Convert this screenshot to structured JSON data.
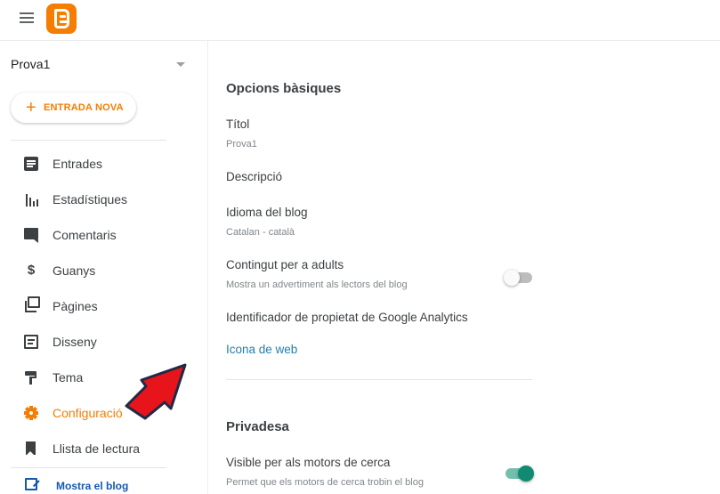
{
  "header": {
    "menu_icon": "hamburger-menu-icon",
    "logo_icon": "blogger-logo-icon",
    "brand_color": "#f57d00"
  },
  "sidebar": {
    "blog_name": "Prova1",
    "new_post_label": "ENTRADA NOVA",
    "items": [
      {
        "label": "Entrades",
        "icon": "posts-icon"
      },
      {
        "label": "Estadístiques",
        "icon": "stats-icon"
      },
      {
        "label": "Comentaris",
        "icon": "comments-icon"
      },
      {
        "label": "Guanys",
        "icon": "dollar-icon"
      },
      {
        "label": "Pàgines",
        "icon": "pages-icon"
      },
      {
        "label": "Disseny",
        "icon": "layout-icon"
      },
      {
        "label": "Tema",
        "icon": "theme-roller-icon"
      },
      {
        "label": "Configuració",
        "icon": "gear-icon",
        "active": true
      },
      {
        "label": "Llista de lectura",
        "icon": "bookmark-icon"
      }
    ],
    "view_blog_label": "Mostra el blog",
    "view_blog_icon": "external-link-icon"
  },
  "main": {
    "basic": {
      "title": "Opcions bàsiques",
      "title_label": "Títol",
      "title_value": "Prova1",
      "description_label": "Descripció",
      "language_label": "Idioma del blog",
      "language_value": "Catalan - català",
      "adult_label": "Contingut per a adults",
      "adult_help": "Mostra un advertiment als lectors del blog",
      "adult_enabled": false,
      "analytics_label": "Identificador de propietat de Google Analytics",
      "favicon_link": "Icona de web"
    },
    "privacy": {
      "title": "Privadesa",
      "search_visible_label": "Visible per als motors de cerca",
      "search_visible_help": "Permet que els motors de cerca trobin el blog",
      "search_visible_enabled": true
    }
  },
  "annotation": {
    "arrow_color": "#e8141c",
    "arrow_icon": "red-arrow-pointer"
  }
}
